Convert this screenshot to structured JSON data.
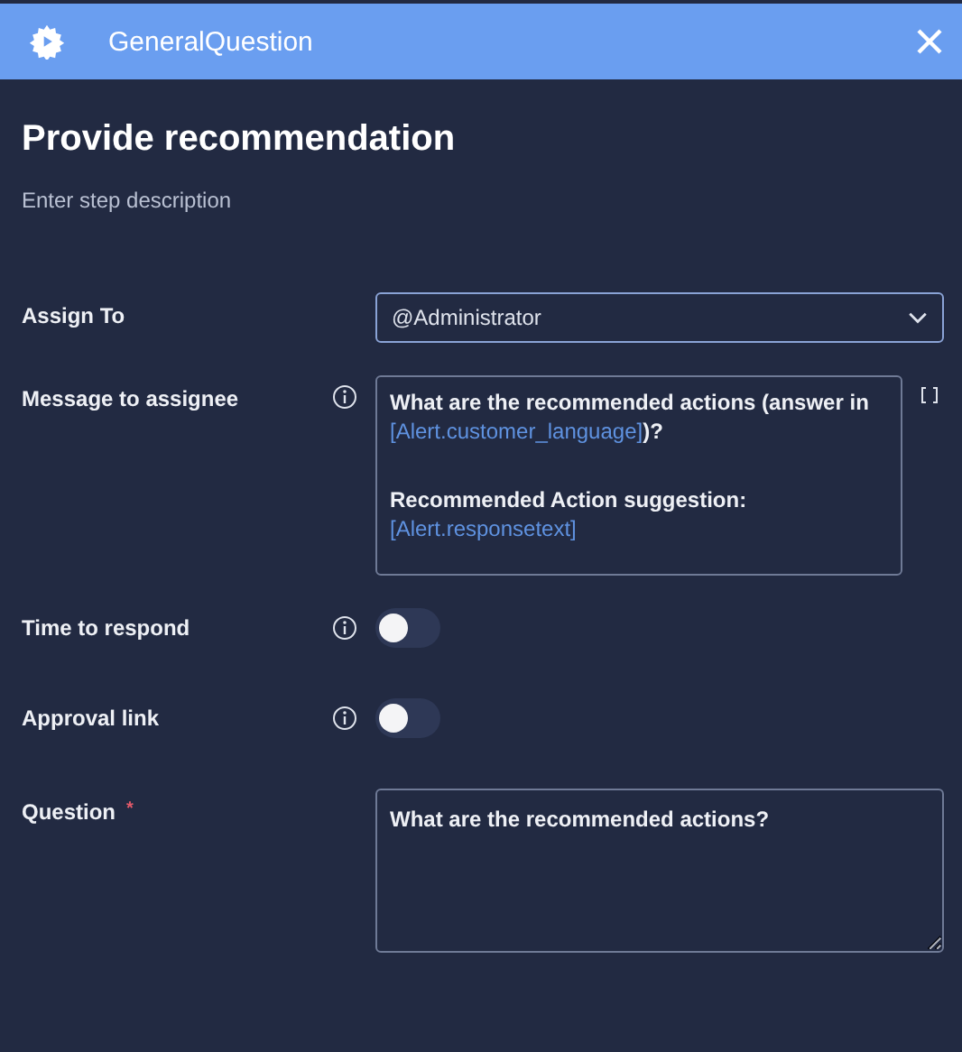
{
  "header": {
    "title": "GeneralQuestion"
  },
  "step": {
    "title": "Provide recommendation",
    "description": "Enter step description"
  },
  "fields": [
    {
      "kind": "select",
      "label": "Assign To",
      "info": false,
      "value": "@Administrator"
    },
    {
      "kind": "message",
      "label": "Message to assignee",
      "info": true,
      "paragraphs": [
        [
          [
            {
              "kind": "plain",
              "text": "What are the recommended actions (answer in"
            }
          ],
          [
            {
              "kind": "variable",
              "text": "[Alert.customer_language]"
            },
            {
              "kind": "plain",
              "text": ")?"
            }
          ]
        ],
        [
          [
            {
              "kind": "plain",
              "text": "Recommended Action suggestion:"
            }
          ],
          [
            {
              "kind": "variable",
              "text": "[Alert.responsetext]"
            }
          ]
        ]
      ]
    },
    {
      "kind": "toggle",
      "label": "Time to respond",
      "info": true,
      "on": false
    },
    {
      "kind": "toggle",
      "label": "Approval link",
      "info": true,
      "on": false
    },
    {
      "kind": "textarea",
      "label": "Question",
      "info": false,
      "required_mark": "*",
      "value": "What are the recommended actions?"
    }
  ]
}
